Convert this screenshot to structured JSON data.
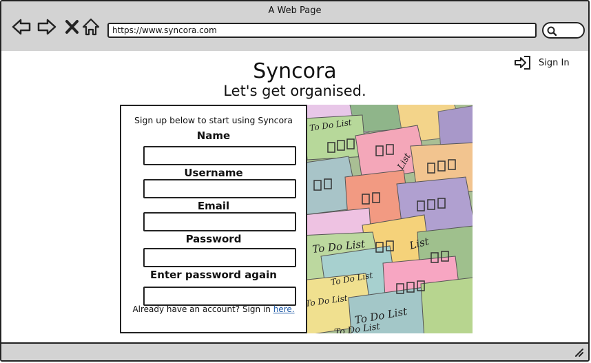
{
  "window": {
    "title": "A Web Page"
  },
  "browser": {
    "url": "https://www.syncora.com",
    "icons": [
      "back-arrow-icon",
      "forward-arrow-icon",
      "close-x-icon",
      "home-icon",
      "search-icon"
    ]
  },
  "header": {
    "signin_label": "Sign In",
    "signin_icon": "sign-in-icon"
  },
  "hero": {
    "app_name": "Syncora",
    "tagline": "Let's get organised."
  },
  "form": {
    "prompt": "Sign up below to start using Syncora",
    "fields": [
      {
        "label": "Name",
        "value": ""
      },
      {
        "label": "Username",
        "value": ""
      },
      {
        "label": "Email",
        "value": ""
      },
      {
        "label": "Password",
        "value": ""
      },
      {
        "label": "Enter password again",
        "value": ""
      }
    ],
    "already_text": "Already have an account? Sign in",
    "signin_link": "here."
  },
  "image": {
    "note_labels": [
      "To Do List",
      "To Do List",
      "To Do List",
      "List",
      "List",
      "To Do List",
      "To Do List",
      "To Do List"
    ]
  }
}
